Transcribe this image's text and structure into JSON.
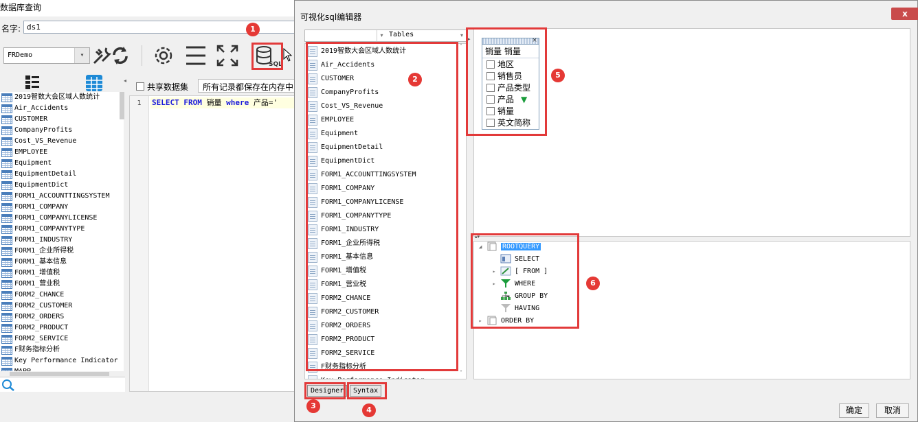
{
  "bg_window": {
    "title": "数据库查询",
    "name_label": "名字:",
    "name_value": "ds1",
    "connection": "FRDemo",
    "share_label": "共享数据集",
    "cache_option": "所有记录都保存在内存中",
    "sql_line_number": "1",
    "sql": {
      "kw1": "SELECT",
      "kw2": "FROM",
      "table": "销量",
      "kw3": "where",
      "rest": "产品='"
    },
    "tables": [
      "2019智数大会区域人数统计",
      "Air_Accidents",
      "CUSTOMER",
      "CompanyProfits",
      "Cost_VS_Revenue",
      "EMPLOYEE",
      "Equipment",
      "EquipmentDetail",
      "EquipmentDict",
      "FORM1_ACCOUNTTINGSYSTEM",
      "FORM1_COMPANY",
      "FORM1_COMPANYLICENSE",
      "FORM1_COMPANYTYPE",
      "FORM1_INDUSTRY",
      "FORM1_企业所得税",
      "FORM1_基本信息",
      "FORM1_增值税",
      "FORM1_营业税",
      "FORM2_CHANCE",
      "FORM2_CUSTOMER",
      "FORM2_ORDERS",
      "FORM2_PRODUCT",
      "FORM2_SERVICE",
      "F财务指标分析",
      "Key Performance Indicator",
      "MAPP"
    ]
  },
  "dialog": {
    "title": "可视化sql编辑器",
    "close": "x",
    "combo_label": "Tables",
    "tables": [
      "2019智数大会区域人数统计",
      "Air_Accidents",
      "CUSTOMER",
      "CompanyProfits",
      "Cost_VS_Revenue",
      "EMPLOYEE",
      "Equipment",
      "EquipmentDetail",
      "EquipmentDict",
      "FORM1_ACCOUNTTINGSYSTEM",
      "FORM1_COMPANY",
      "FORM1_COMPANYLICENSE",
      "FORM1_COMPANYTYPE",
      "FORM1_INDUSTRY",
      "FORM1_企业所得税",
      "FORM1_基本信息",
      "FORM1_增值税",
      "FORM1_营业税",
      "FORM2_CHANCE",
      "FORM2_CUSTOMER",
      "FORM2_ORDERS",
      "FORM2_PRODUCT",
      "FORM2_SERVICE",
      "F财务指标分析",
      "Key Performance Indicator"
    ],
    "table_widget": {
      "title": "销量 销量",
      "fields": [
        "地区",
        "销售员",
        "产品类型",
        "产品",
        "销量",
        "英文简称"
      ],
      "filtered_field": "产品"
    },
    "tree": {
      "root": "ROOTQUERY",
      "nodes": [
        "SELECT",
        "[ FROM ]",
        "WHERE",
        "GROUP BY",
        "HAVING",
        "ORDER BY"
      ]
    },
    "tabs": {
      "designer": "Designer",
      "syntax": "Syntax"
    },
    "buttons": {
      "ok": "确定",
      "cancel": "取消"
    }
  },
  "badges": [
    "1",
    "2",
    "3",
    "4",
    "5",
    "6"
  ],
  "colors": {
    "highlight_red": "#e23a3a",
    "badge_red": "#e53935",
    "keyword_blue": "#1a1adb",
    "selected_root": "#3399ff",
    "filter_green": "#1a9c3b"
  }
}
